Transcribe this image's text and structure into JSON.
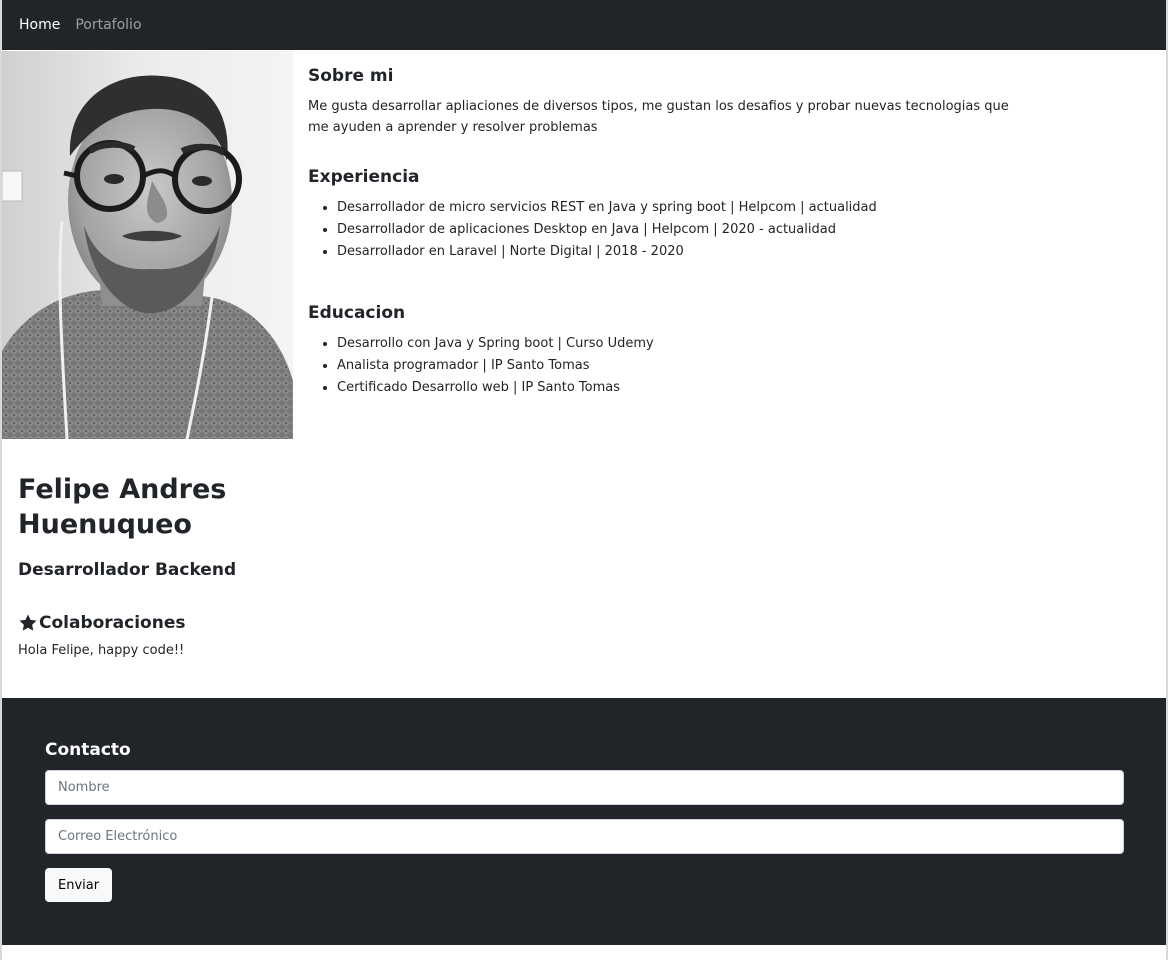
{
  "navbar": {
    "items": [
      {
        "label": "Home",
        "active": true
      },
      {
        "label": "Portafolio",
        "active": false
      }
    ],
    "background": "#212529"
  },
  "about": {
    "title": "Sobre mi",
    "text": "Me gusta desarrollar apliaciones de diversos tipos, me gustan los desafios y probar nuevas tecnologias que me ayuden a aprender y resolver problemas"
  },
  "experience": {
    "title": "Experiencia",
    "items": [
      "Desarrollador de micro servicios REST en Java y spring boot | Helpcom | actualidad",
      "Desarrollador de aplicaciones Desktop en Java | Helpcom | 2020 - actualidad",
      "Desarrollador en Laravel | Norte Digital | 2018 - 2020"
    ]
  },
  "education": {
    "title": "Educacion",
    "items": [
      "Desarrollo con Java y Spring boot | Curso Udemy",
      "Analista programador | IP Santo Tomas",
      "Certificado Desarrollo web | IP Santo Tomas"
    ]
  },
  "profile": {
    "name_line1": "Felipe Andres",
    "name_line2": "Huenuqueo",
    "role": "Desarrollador Backend",
    "collab_title": "Colaboraciones",
    "collab_icon": "star-icon",
    "collab_text": "Hola Felipe, happy code!!"
  },
  "contact": {
    "title": "Contacto",
    "name_placeholder": "Nombre",
    "email_placeholder": "Correo Electrónico",
    "submit_label": "Enviar",
    "background": "#212529"
  }
}
